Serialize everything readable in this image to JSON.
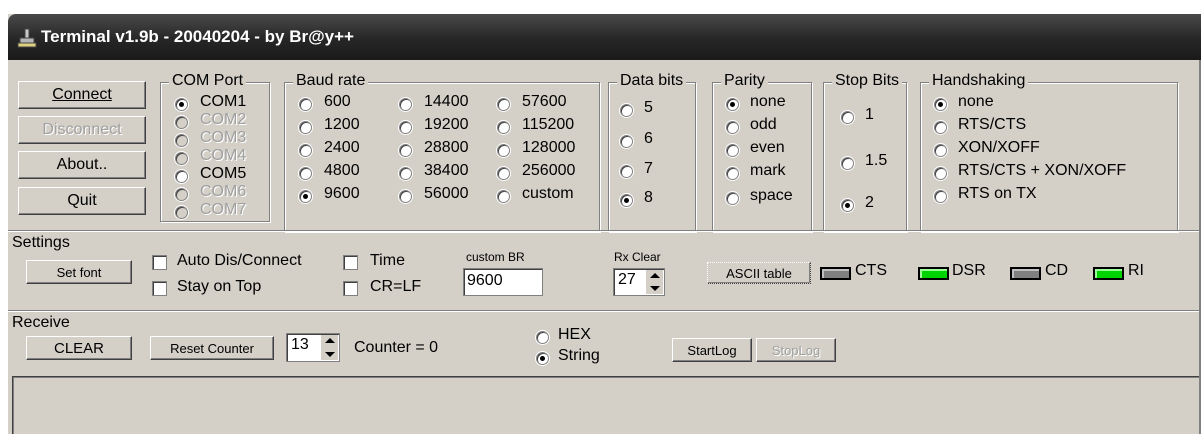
{
  "window": {
    "title": "Terminal v1.9b - 20040204 - by Br@y++"
  },
  "buttons": {
    "connect": "Connect",
    "disconnect": "Disconnect",
    "about": "About..",
    "quit": "Quit",
    "set_font": "Set font",
    "clear": "CLEAR",
    "reset_counter": "Reset Counter",
    "ascii_table": "ASCII table",
    "start_log": "StartLog",
    "stop_log": "StopLog"
  },
  "com_port": {
    "label": "COM Port",
    "options": [
      "COM1",
      "COM2",
      "COM3",
      "COM4",
      "COM5",
      "COM6",
      "COM7"
    ],
    "selected": "COM1"
  },
  "baud_rate": {
    "label": "Baud rate",
    "options": [
      "600",
      "1200",
      "2400",
      "4800",
      "9600",
      "14400",
      "19200",
      "28800",
      "38400",
      "56000",
      "57600",
      "115200",
      "128000",
      "256000",
      "custom"
    ],
    "selected": "9600"
  },
  "data_bits": {
    "label": "Data bits",
    "options": [
      "5",
      "6",
      "7",
      "8"
    ],
    "selected": "8"
  },
  "parity": {
    "label": "Parity",
    "options": [
      "none",
      "odd",
      "even",
      "mark",
      "space"
    ],
    "selected": "none"
  },
  "stop_bits": {
    "label": "Stop Bits",
    "options": [
      "1",
      "1.5",
      "2"
    ],
    "selected": "2"
  },
  "handshaking": {
    "label": "Handshaking",
    "options": [
      "none",
      "RTS/CTS",
      "XON/XOFF",
      "RTS/CTS + XON/XOFF",
      "RTS on TX"
    ],
    "selected": "none"
  },
  "settings": {
    "label": "Settings",
    "auto_dis_connect": "Auto Dis/Connect",
    "stay_on_top": "Stay on Top",
    "time": "Time",
    "cr_lf": "CR=LF",
    "custom_br_label": "custom BR",
    "custom_br_value": "9600",
    "rx_clear_label": "Rx Clear",
    "rx_clear_value": "27",
    "cts": "CTS",
    "dsr": "DSR",
    "cd": "CD",
    "ri": "RI"
  },
  "receive": {
    "label": "Receive",
    "counter_spin_value": "13",
    "counter_text": "Counter = 0",
    "hex": "HEX",
    "string": "String",
    "mode_selected": "String"
  },
  "colors": {
    "led_on": "#00d400",
    "led_off": "#808080",
    "face": "#d4d0c8"
  }
}
